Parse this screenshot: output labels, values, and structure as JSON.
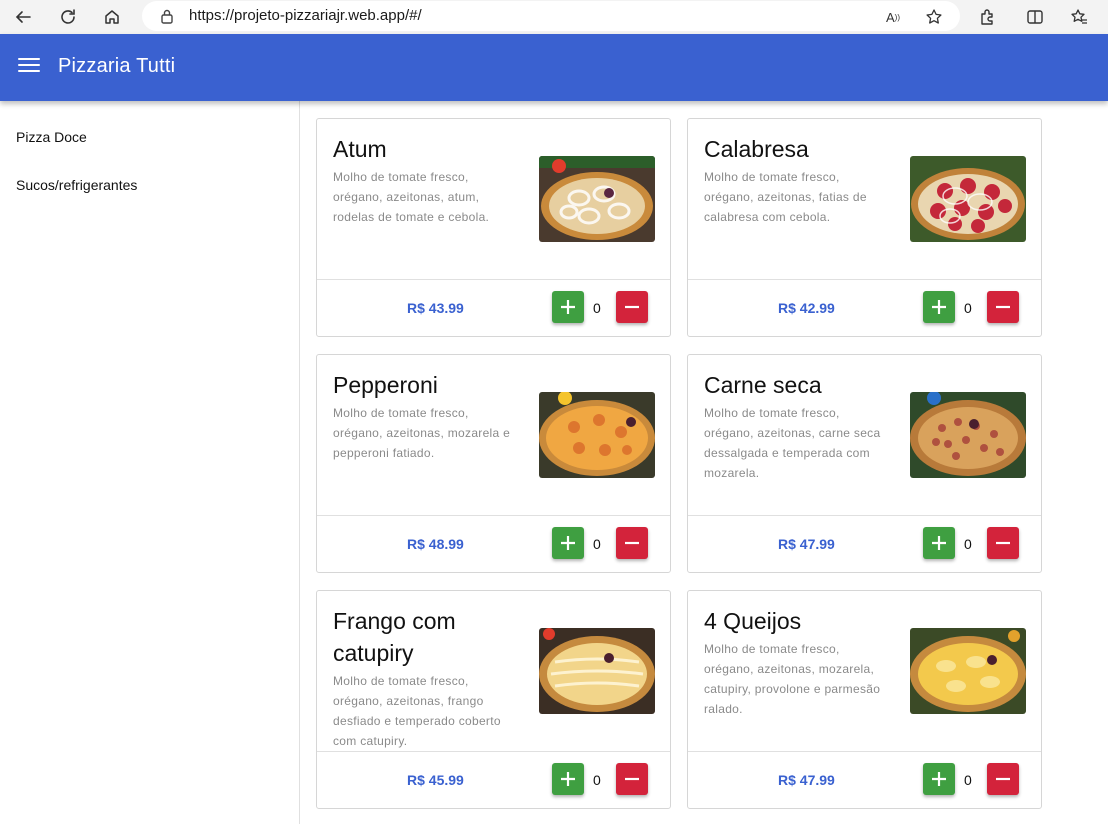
{
  "browser": {
    "url": "https://projeto-pizzariajr.web.app/#/"
  },
  "header": {
    "title": "Pizzaria Tutti"
  },
  "sidebar": {
    "items": [
      {
        "label": "Pizza Doce"
      },
      {
        "label": "Sucos/refrigerantes"
      }
    ]
  },
  "products": [
    {
      "name": "Atum",
      "description": "Molho de tomate fresco, orégano, azeitonas, atum, rodelas de tomate e cebola.",
      "price": "R$ 43.99",
      "qty": "0"
    },
    {
      "name": "Calabresa",
      "description": "Molho de tomate fresco, orégano, azeitonas, fatias de calabresa com cebola.",
      "price": "R$ 42.99",
      "qty": "0"
    },
    {
      "name": "Pepperoni",
      "description": "Molho de tomate fresco, orégano, azeitonas, mozarela e pepperoni fatiado.",
      "price": "R$ 48.99",
      "qty": "0"
    },
    {
      "name": "Carne seca",
      "description": "Molho de tomate fresco, orégano, azeitonas, carne seca dessalgada e temperada com mozarela.",
      "price": "R$ 47.99",
      "qty": "0"
    },
    {
      "name": "Frango com catupiry",
      "description": "Molho de tomate fresco, orégano, azeitonas, frango desfiado e temperado coberto com catupiry.",
      "price": "R$ 45.99",
      "qty": "0"
    },
    {
      "name": "4 Queijos",
      "description": "Molho de tomate fresco, orégano, azeitonas, mozarela, catupiry, provolone e parmesão ralado.",
      "price": "R$ 47.99",
      "qty": "0"
    }
  ],
  "colors": {
    "header": "#3a61d0",
    "plus": "#3f9f41",
    "minus": "#d3233b",
    "price": "#3a61d0"
  }
}
